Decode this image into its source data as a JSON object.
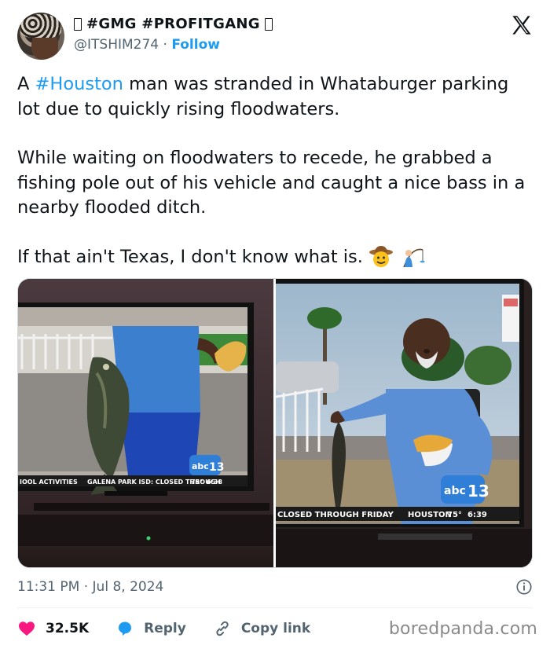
{
  "user": {
    "display_name": "#GMG #PROFITGANG",
    "handle": "@ITSHIM274",
    "separator": "·",
    "follow_label": "Follow"
  },
  "tweet": {
    "p1_prefix": "A ",
    "p1_hashtag": "#Houston",
    "p1_rest": " man was stranded in Whataburger parking lot due to quickly rising floodwaters.",
    "p2": "While waiting on floodwaters to recede, he grabbed a fishing pole out of his vehicle and caught a nice bass in a nearby flooded ditch.",
    "p3": "If that ain't Texas, I don't know what is.",
    "emojis": [
      "cowboy-face",
      "person-fishing"
    ]
  },
  "media": {
    "left": {
      "ticker": "IOOL ACTIVITIES",
      "ticker2": "GALENA PARK ISD: CLOSED THROUGH",
      "temp": "75°",
      "time": "6:38",
      "logo": "abc",
      "logo_num": "13"
    },
    "right": {
      "ticker": "CLOSED THROUGH FRIDAY",
      "city": "HOUSTON",
      "temp": "75°",
      "time": "6:39",
      "logo": "abc",
      "logo_num": "13"
    }
  },
  "meta": {
    "time": "11:31 PM",
    "separator": "·",
    "date": "Jul 8, 2024"
  },
  "actions": {
    "likes": "32.5K",
    "reply": "Reply",
    "copy_link": "Copy link"
  },
  "watermark": "boredpanda.com",
  "colors": {
    "accent": "#1d9bf0",
    "like": "#f91880",
    "muted": "#536471"
  }
}
